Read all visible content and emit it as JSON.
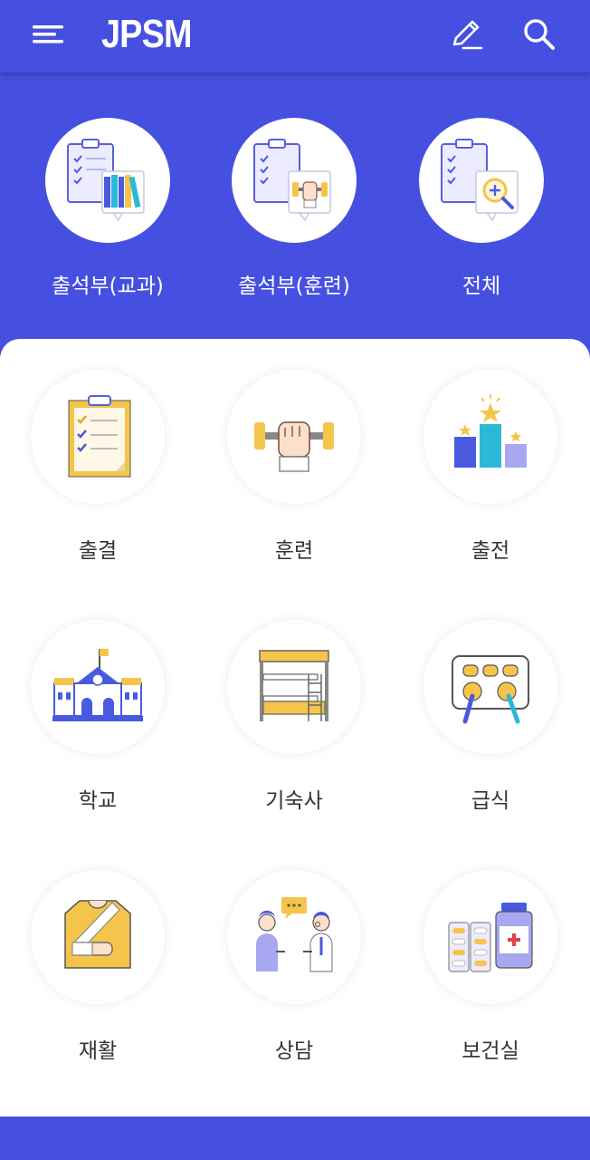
{
  "header": {
    "title": "JPSM",
    "menu_icon": "hamburger-icon",
    "edit_icon": "pencil-icon",
    "search_icon": "search-icon"
  },
  "hero": {
    "items": [
      {
        "label": "출석부(교과)",
        "icon": "clipboard-books-icon"
      },
      {
        "label": "출석부(훈련)",
        "icon": "clipboard-dumbbell-icon"
      },
      {
        "label": "전체",
        "icon": "clipboard-magnifier-icon"
      }
    ]
  },
  "menu": {
    "items": [
      {
        "label": "출결",
        "icon": "checklist-clipboard-icon"
      },
      {
        "label": "훈련",
        "icon": "dumbbell-fist-icon"
      },
      {
        "label": "출전",
        "icon": "podium-icon"
      },
      {
        "label": "학교",
        "icon": "school-icon"
      },
      {
        "label": "기숙사",
        "icon": "bunk-bed-icon"
      },
      {
        "label": "급식",
        "icon": "meal-tray-icon"
      },
      {
        "label": "재활",
        "icon": "arm-sling-icon"
      },
      {
        "label": "상담",
        "icon": "counseling-icon"
      },
      {
        "label": "보건실",
        "icon": "medicine-icon"
      }
    ]
  },
  "colors": {
    "primary": "#4650e0",
    "accent_yellow": "#f4c54a",
    "icon_blue": "#4a5ae0",
    "icon_teal": "#2bb8d8"
  }
}
